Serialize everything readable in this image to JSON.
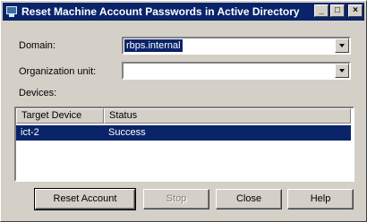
{
  "window": {
    "title": "Reset Machine Account Passwords in Active Directory",
    "minimize_glyph": "_",
    "maximize_glyph": "□",
    "close_glyph": "×"
  },
  "form": {
    "domain_label": "Domain:",
    "domain_value": "rbps.internal",
    "ou_label": "Organization unit:",
    "ou_value": "",
    "devices_label": "Devices:"
  },
  "devices_table": {
    "columns": [
      "Target Device",
      "Status"
    ],
    "rows": [
      {
        "target_device": "ict-2",
        "status": "Success",
        "selected": true
      }
    ]
  },
  "buttons": {
    "reset_label": "Reset Account",
    "stop_label": "Stop",
    "close_label": "Close",
    "help_label": "Help"
  }
}
